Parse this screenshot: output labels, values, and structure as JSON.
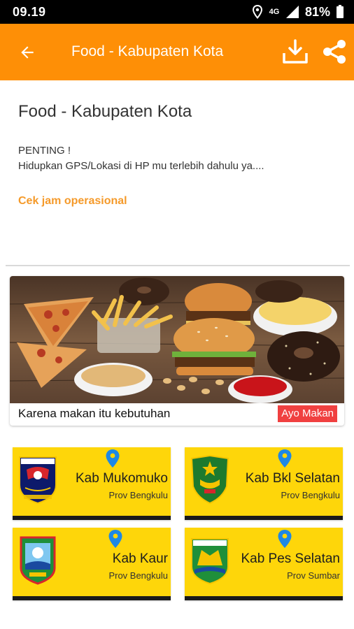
{
  "status_bar": {
    "time": "09.19",
    "network": "4G",
    "battery": "81%"
  },
  "app_bar": {
    "title": "Food - Kabupaten Kota"
  },
  "content": {
    "title": "Food - Kabupaten Kota",
    "notice_head": "PENTING !",
    "notice_body": "Hidupkan GPS/Lokasi di HP mu terlebih dahulu ya....",
    "hours_link": "Cek jam operasional"
  },
  "banner": {
    "caption": "Karena makan itu kebutuhan",
    "button": "Ayo Makan"
  },
  "regions": [
    {
      "name": "Kab Mukomuko",
      "province": "Prov Bengkulu"
    },
    {
      "name": "Kab Bkl Selatan",
      "province": "Prov Bengkulu"
    },
    {
      "name": "Kab Kaur",
      "province": "Prov Bengkulu"
    },
    {
      "name": "Kab Pes Selatan",
      "province": "Prov Sumbar"
    }
  ],
  "colors": {
    "app_bar": "#fe8f06",
    "card": "#fed60a",
    "link": "#f59a2a",
    "button": "#f04040",
    "pin": "#1e88e5"
  }
}
